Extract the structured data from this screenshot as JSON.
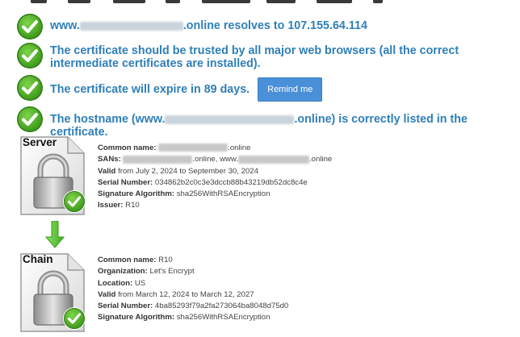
{
  "checks": [
    {
      "prefix": "www.",
      "suffix": ".online resolves to 107.155.64.114"
    },
    {
      "text": "The certificate should be trusted by all major web browsers (all the correct intermediate certificates are installed)."
    },
    {
      "text": "The certificate will expire in 89 days.",
      "button": "Remind me"
    },
    {
      "prefix": "The hostname (www.",
      "suffix": ".online) is correctly listed in the certificate."
    }
  ],
  "server": {
    "label": "Server",
    "common_name_label": "Common name:",
    "common_name_suffix": ".online",
    "sans_label": "SANs:",
    "sans_mid": ".online, www.",
    "sans_suffix": ".online",
    "valid_label": "Valid",
    "valid_value": "from July 2, 2024 to September 30, 2024",
    "serial_label": "Serial Number:",
    "serial_value": "034862b2c0c3e3dccb88b43219db52dc8c4e",
    "sigalg_label": "Signature Algorithm:",
    "sigalg_value": "sha256WithRSAEncryption",
    "issuer_label": "Issuer:",
    "issuer_value": "R10"
  },
  "chain": {
    "label": "Chain",
    "common_name_label": "Common name:",
    "common_name_value": "R10",
    "org_label": "Organization:",
    "org_value": "Let's Encrypt",
    "location_label": "Location:",
    "location_value": "US",
    "valid_label": "Valid",
    "valid_value": "from March 12, 2024 to March 12, 2027",
    "serial_label": "Serial Number:",
    "serial_value": "4ba85293f79a2fa273064ba8048d75d0",
    "sigalg_label": "Signature Algorithm:",
    "sigalg_value": "sha256WithRSAEncryption"
  },
  "colors": {
    "link": "#2f7fb8",
    "check": "#5cb82a",
    "button": "#4a90d9",
    "arrow": "#5ec13a"
  },
  "icons": [
    "check-circle-icon",
    "padlock-certificate-icon",
    "down-arrow-icon"
  ]
}
